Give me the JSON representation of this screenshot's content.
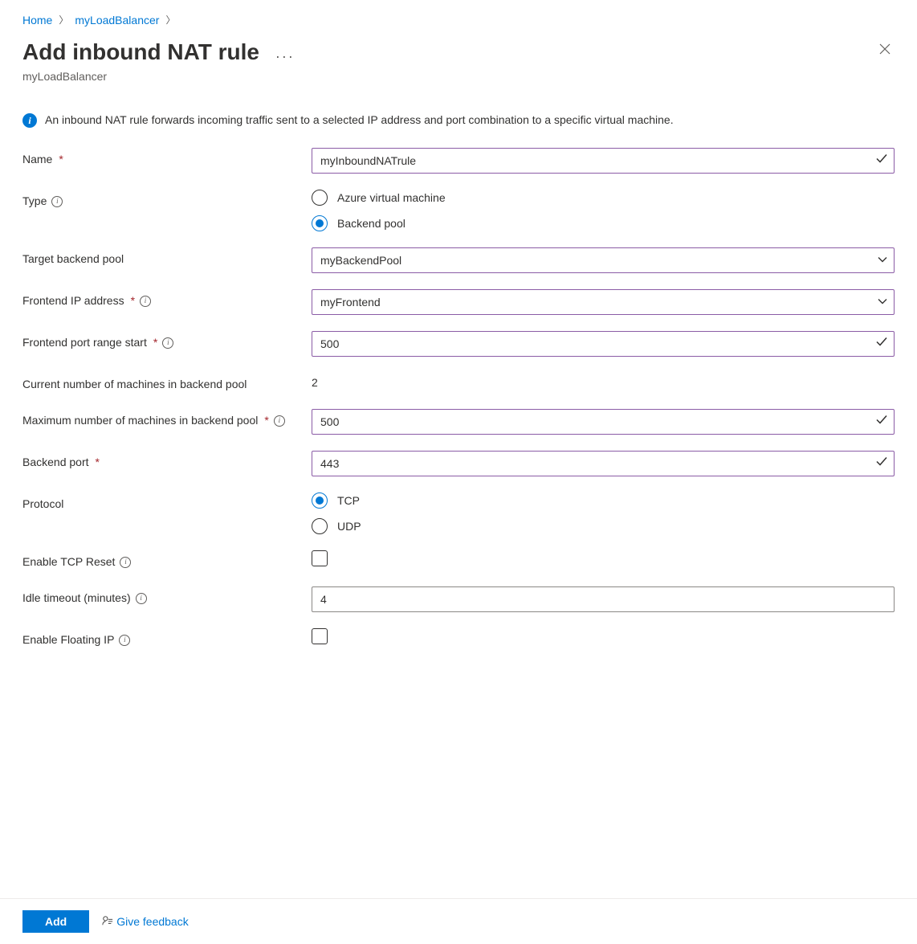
{
  "breadcrumb": {
    "home": "Home",
    "resource": "myLoadBalancer"
  },
  "header": {
    "title": "Add inbound NAT rule",
    "subtitle": "myLoadBalancer"
  },
  "info": {
    "text": "An inbound NAT rule forwards incoming traffic sent to a selected IP address and port combination to a specific virtual machine."
  },
  "form": {
    "name": {
      "label": "Name",
      "value": "myInboundNATrule"
    },
    "type": {
      "label": "Type",
      "options": {
        "vm": "Azure virtual machine",
        "pool": "Backend pool"
      },
      "selected": "pool"
    },
    "target_backend_pool": {
      "label": "Target backend pool",
      "value": "myBackendPool"
    },
    "frontend_ip": {
      "label": "Frontend IP address",
      "value": "myFrontend"
    },
    "frontend_port_start": {
      "label": "Frontend port range start",
      "value": "500"
    },
    "current_machines": {
      "label": "Current number of machines in backend pool",
      "value": "2"
    },
    "max_machines": {
      "label": "Maximum number of machines in backend pool",
      "value": "500"
    },
    "backend_port": {
      "label": "Backend port",
      "value": "443"
    },
    "protocol": {
      "label": "Protocol",
      "options": {
        "tcp": "TCP",
        "udp": "UDP"
      },
      "selected": "tcp"
    },
    "tcp_reset": {
      "label": "Enable TCP Reset",
      "checked": false
    },
    "idle_timeout": {
      "label": "Idle timeout (minutes)",
      "value": "4"
    },
    "floating_ip": {
      "label": "Enable Floating IP",
      "checked": false
    }
  },
  "footer": {
    "add": "Add",
    "feedback": "Give feedback"
  }
}
